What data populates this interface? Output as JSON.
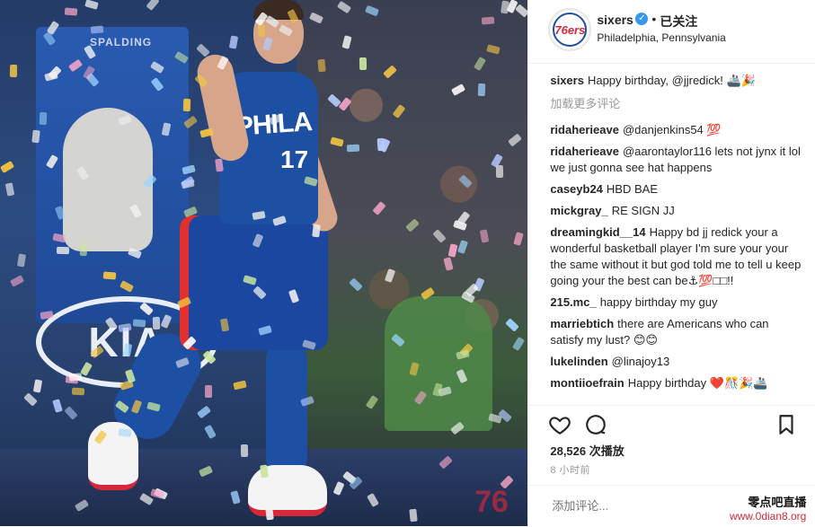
{
  "post": {
    "username": "sixers",
    "follow_status": "已关注",
    "separator": "•",
    "location": "Philadelphia, Pennsylvania",
    "avatar_text": "76ers"
  },
  "image": {
    "backboard_brand": "SPALDING",
    "sponsor": "KIA",
    "jersey_text": "PHILA",
    "jersey_number": "17",
    "floor_mark": "76"
  },
  "caption": {
    "user": "sixers",
    "text": "Happy birthday, @jjredick! 🚢🎉"
  },
  "load_more": "加载更多评论",
  "comments": [
    {
      "user": "ridaherieave",
      "text": "@danjenkins54 💯"
    },
    {
      "user": "ridaherieave",
      "text": "@aarontaylor116 lets not jynx it lol we just gonna see hat happens"
    },
    {
      "user": "caseyb24",
      "text": "HBD BAE"
    },
    {
      "user": "mickgray_",
      "text": "RE SIGN JJ"
    },
    {
      "user": "dreamingkid__14",
      "text": "Happy bd jj redick your a wonderful basketball player I'm sure your your the same without it but god told me to tell u keep going your the best can be⚓💯□□!!"
    },
    {
      "user": "215.mc_",
      "text": "happy birthday my guy"
    },
    {
      "user": "marriebtich",
      "text": "there are Americans who can satisfy my lust? 😊😊"
    },
    {
      "user": "lukelinden",
      "text": "@linajoy13"
    },
    {
      "user": "montiioefrain",
      "text": "Happy birthday ❤️🎊🎉🚢"
    }
  ],
  "likes": "28,526 次播放",
  "time": "8 小时前",
  "add_comment_placeholder": "添加评论...",
  "watermark": {
    "title": "零点吧直播",
    "url": "www.0dian8.org"
  },
  "icons": {
    "like": "heart-icon",
    "comment": "comment-icon",
    "save": "bookmark-icon",
    "verified": "verified-badge-icon"
  },
  "colors": {
    "accent_blue": "#1d4fa3",
    "accent_red": "#d6283a",
    "verified_blue": "#3897f0",
    "muted_text": "#999999"
  }
}
